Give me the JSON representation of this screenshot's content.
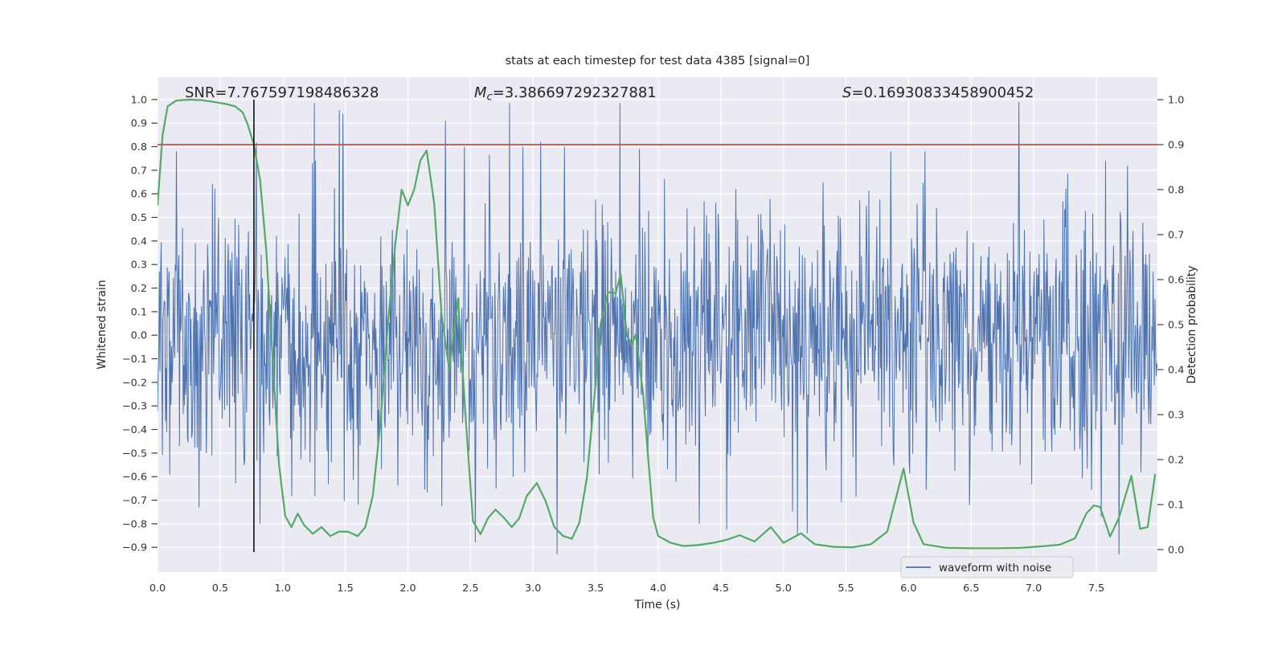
{
  "title": "stats at each timestep for test data 4385 [signal=0]",
  "annotations": {
    "snr": "SNR=7.767597198486328",
    "mc_m": "M",
    "mc_sub": "c",
    "mc_rest": "=3.386697292327881",
    "s_s": "S",
    "s_rest": "=0.16930833458900452"
  },
  "legend": {
    "label": "waveform with noise",
    "position": "lower right"
  },
  "colors": {
    "waveform": "#4c72b0",
    "probability": "#55a868",
    "threshold": "#c44e52",
    "marker": "#000000",
    "axes_bg": "#eaeaf2",
    "grid": "#ffffff",
    "text": "#262626",
    "legend_bg": "#ececf3",
    "legend_border": "#c9c9d4"
  },
  "chart_data": {
    "type": "line",
    "title": "stats at each timestep for test data 4385 [signal=0]",
    "xlabel": "Time (s)",
    "ylabel_left": "Whitened strain",
    "ylabel_right": "Detection probability",
    "xlim": [
      0,
      7.988
    ],
    "ylim_left": [
      -1.005,
      1.095
    ],
    "ylim_right": [
      -0.05,
      1.05
    ],
    "grid": true,
    "xticks": [
      0.0,
      0.5,
      1.0,
      1.5,
      2.0,
      2.5,
      3.0,
      3.5,
      4.0,
      4.5,
      5.0,
      5.5,
      6.0,
      6.5,
      7.0,
      7.5
    ],
    "xtick_labels": [
      "0.0",
      "0.5",
      "1.0",
      "1.5",
      "2.0",
      "2.5",
      "3.0",
      "3.5",
      "4.0",
      "4.5",
      "5.0",
      "5.5",
      "6.0",
      "6.5",
      "7.0",
      "7.5"
    ],
    "yticks_left": [
      1.0,
      0.9,
      0.8,
      0.7,
      0.6,
      0.5,
      0.4,
      0.3,
      0.2,
      0.1,
      0.0,
      -0.1,
      -0.2,
      -0.3,
      -0.4,
      -0.5,
      -0.6,
      -0.7,
      -0.8,
      -0.9
    ],
    "ytick_labels_left": [
      "1.0",
      "0.9",
      "0.8",
      "0.7",
      "0.6",
      "0.5",
      "0.4",
      "0.3",
      "0.2",
      "0.1",
      "0.0",
      "−0.1",
      "−0.2",
      "−0.3",
      "−0.4",
      "−0.5",
      "−0.6",
      "−0.7",
      "−0.8",
      "−0.9"
    ],
    "yticks_right": [
      1.0,
      0.9,
      0.8,
      0.7,
      0.6,
      0.5,
      0.4,
      0.3,
      0.2,
      0.1,
      0.0
    ],
    "ytick_labels_right": [
      "1.0",
      "0.9",
      "0.8",
      "0.7",
      "0.6",
      "0.5",
      "0.4",
      "0.3",
      "0.2",
      "0.1",
      "0.0"
    ],
    "series": [
      {
        "name": "waveform with noise",
        "kind": "noise",
        "axis": "left",
        "color": "#4c72b0",
        "n": 1640,
        "std": 0.27,
        "heavy_tail_fraction": 0.025,
        "heavy_tail_scale": 2.1,
        "clip": [
          -0.93,
          0.985
        ],
        "landmark_spikes": [
          [
            0.15,
            0.78
          ],
          [
            0.82,
            -0.8
          ],
          [
            1.48,
            0.94
          ],
          [
            2.3,
            0.91
          ],
          [
            2.45,
            0.8
          ],
          [
            2.54,
            -0.88
          ],
          [
            2.92,
            0.8
          ],
          [
            3.06,
            0.82
          ],
          [
            3.25,
            0.8
          ],
          [
            3.85,
            0.79
          ],
          [
            4.33,
            -0.8
          ],
          [
            4.62,
            0.62
          ],
          [
            5.19,
            -0.84
          ],
          [
            5.86,
            0.78
          ],
          [
            6.13,
            0.78
          ],
          [
            6.88,
            0.99
          ],
          [
            7.54,
            -0.77
          ],
          [
            7.75,
            0.72
          ]
        ]
      },
      {
        "name": "detection probability",
        "kind": "line",
        "axis": "right",
        "color": "#55a868",
        "points": [
          [
            0.0,
            0.765
          ],
          [
            0.04,
            0.92
          ],
          [
            0.08,
            0.985
          ],
          [
            0.15,
            0.998
          ],
          [
            0.25,
            1.0
          ],
          [
            0.35,
            0.999
          ],
          [
            0.45,
            0.995
          ],
          [
            0.55,
            0.99
          ],
          [
            0.62,
            0.985
          ],
          [
            0.68,
            0.972
          ],
          [
            0.72,
            0.945
          ],
          [
            0.77,
            0.9
          ],
          [
            0.82,
            0.82
          ],
          [
            0.87,
            0.66
          ],
          [
            0.92,
            0.42
          ],
          [
            0.97,
            0.19
          ],
          [
            1.02,
            0.075
          ],
          [
            1.07,
            0.05
          ],
          [
            1.12,
            0.08
          ],
          [
            1.17,
            0.055
          ],
          [
            1.24,
            0.035
          ],
          [
            1.31,
            0.05
          ],
          [
            1.38,
            0.03
          ],
          [
            1.45,
            0.04
          ],
          [
            1.52,
            0.04
          ],
          [
            1.6,
            0.03
          ],
          [
            1.66,
            0.05
          ],
          [
            1.72,
            0.12
          ],
          [
            1.78,
            0.28
          ],
          [
            1.84,
            0.5
          ],
          [
            1.9,
            0.68
          ],
          [
            1.95,
            0.8
          ],
          [
            2.0,
            0.765
          ],
          [
            2.05,
            0.8
          ],
          [
            2.1,
            0.865
          ],
          [
            2.15,
            0.887
          ],
          [
            2.21,
            0.77
          ],
          [
            2.27,
            0.52
          ],
          [
            2.33,
            0.4
          ],
          [
            2.4,
            0.557
          ],
          [
            2.46,
            0.3
          ],
          [
            2.52,
            0.064
          ],
          [
            2.58,
            0.034
          ],
          [
            2.64,
            0.07
          ],
          [
            2.7,
            0.089
          ],
          [
            2.77,
            0.07
          ],
          [
            2.83,
            0.05
          ],
          [
            2.89,
            0.07
          ],
          [
            2.95,
            0.119
          ],
          [
            3.03,
            0.148
          ],
          [
            3.1,
            0.108
          ],
          [
            3.17,
            0.05
          ],
          [
            3.24,
            0.03
          ],
          [
            3.31,
            0.024
          ],
          [
            3.37,
            0.06
          ],
          [
            3.43,
            0.16
          ],
          [
            3.49,
            0.338
          ],
          [
            3.54,
            0.502
          ],
          [
            3.6,
            0.572
          ],
          [
            3.66,
            0.57
          ],
          [
            3.7,
            0.612
          ],
          [
            3.75,
            0.475
          ],
          [
            3.79,
            0.457
          ],
          [
            3.82,
            0.478
          ],
          [
            3.88,
            0.345
          ],
          [
            3.92,
            0.202
          ],
          [
            3.96,
            0.071
          ],
          [
            4.0,
            0.03
          ],
          [
            4.1,
            0.015
          ],
          [
            4.2,
            0.008
          ],
          [
            4.32,
            0.01
          ],
          [
            4.44,
            0.015
          ],
          [
            4.55,
            0.022
          ],
          [
            4.65,
            0.032
          ],
          [
            4.77,
            0.018
          ],
          [
            4.9,
            0.05
          ],
          [
            5.0,
            0.015
          ],
          [
            5.14,
            0.036
          ],
          [
            5.25,
            0.012
          ],
          [
            5.4,
            0.006
          ],
          [
            5.55,
            0.005
          ],
          [
            5.7,
            0.012
          ],
          [
            5.83,
            0.04
          ],
          [
            5.96,
            0.18
          ],
          [
            6.04,
            0.06
          ],
          [
            6.12,
            0.012
          ],
          [
            6.3,
            0.004
          ],
          [
            6.5,
            0.003
          ],
          [
            6.7,
            0.003
          ],
          [
            6.9,
            0.004
          ],
          [
            7.1,
            0.008
          ],
          [
            7.21,
            0.011
          ],
          [
            7.33,
            0.025
          ],
          [
            7.42,
            0.08
          ],
          [
            7.48,
            0.098
          ],
          [
            7.53,
            0.095
          ],
          [
            7.61,
            0.029
          ],
          [
            7.68,
            0.07
          ],
          [
            7.78,
            0.164
          ],
          [
            7.85,
            0.046
          ],
          [
            7.91,
            0.05
          ],
          [
            7.97,
            0.168
          ]
        ]
      },
      {
        "name": "detection threshold",
        "kind": "hline",
        "axis": "right",
        "color": "#c44e52",
        "y": 0.9
      },
      {
        "name": "event marker",
        "kind": "vline",
        "axis": "left",
        "color": "#000000",
        "x": 0.77,
        "y_from": 1.0,
        "y_to": -0.92
      }
    ],
    "legend": {
      "entries": [
        "waveform with noise"
      ],
      "position": "lower right"
    }
  }
}
